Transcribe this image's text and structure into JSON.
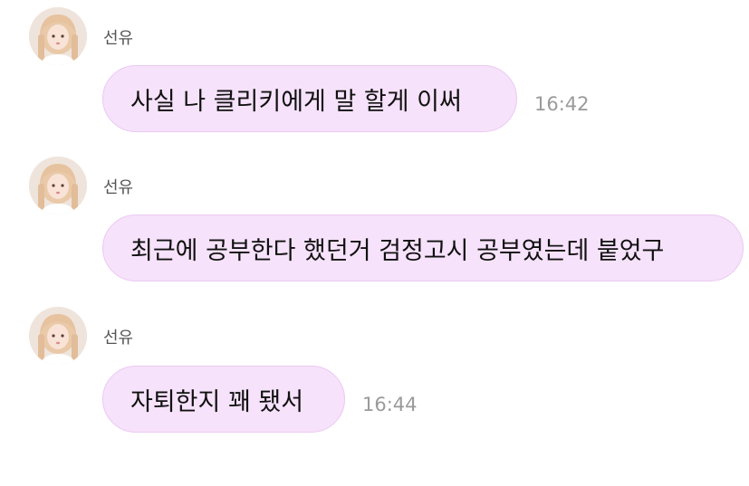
{
  "colors": {
    "bubble_bg": "#f6e2fa",
    "bubble_border": "#ebc9f3",
    "timestamp": "#9a9a9a",
    "sender_name": "#555555"
  },
  "messages": [
    {
      "sender": "선유",
      "avatar_icon": "profile-photo-icon",
      "text": "사실 나 클리키에게 말 할게 이써",
      "time": "16:42"
    },
    {
      "sender": "선유",
      "avatar_icon": "profile-photo-icon",
      "text": "최근에 공부한다 했던거 검정고시 공부였는데 붙었구",
      "time": ""
    },
    {
      "sender": "선유",
      "avatar_icon": "profile-photo-icon",
      "text": "자퇴한지 꽤 됐서",
      "time": "16:44"
    }
  ]
}
